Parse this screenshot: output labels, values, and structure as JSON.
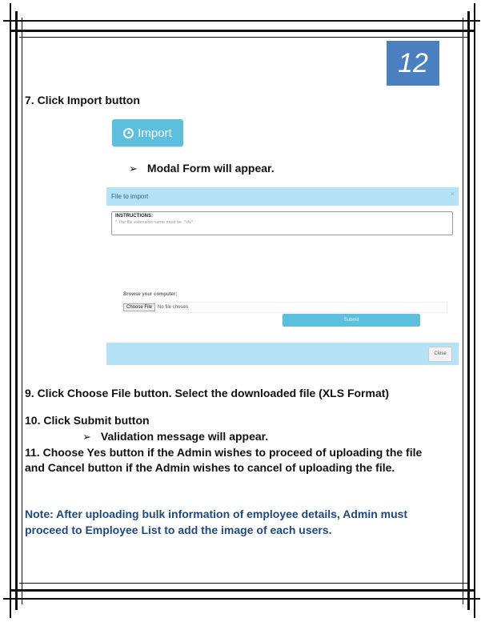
{
  "page_number": "12",
  "steps": {
    "step7": "7. Click Import button",
    "import_button_label": "Import",
    "modal_appear": "Modal Form will appear.",
    "step9": "9. Click Choose File button. Select the downloaded file (XLS Format)",
    "step10": "10. Click Submit button",
    "validation": "Validation message will appear.",
    "step11": "11. Choose Yes button if the Admin wishes to proceed of uploading the file and Cancel button if the Admin wishes to cancel of uploading the file."
  },
  "bullet_glyph": "➢",
  "modal": {
    "title": "File to import",
    "close": "×",
    "instructions_title": "INSTRUCTIONS:",
    "instructions_text": "* The file extension name must be .*xls*.",
    "browse_label": "Browse your computer:",
    "choose_file": "Choose File",
    "no_file": "No file chosen",
    "submit": "Submit",
    "close_button": "Close"
  },
  "note": "Note: After uploading bulk information of employee details, Admin must proceed to Employee List to add the image of each users.",
  "colors": {
    "badge": "#4a7fc1",
    "button": "#5bbfdd",
    "modal_bar": "#b5e2f7",
    "note": "#1f497d"
  }
}
